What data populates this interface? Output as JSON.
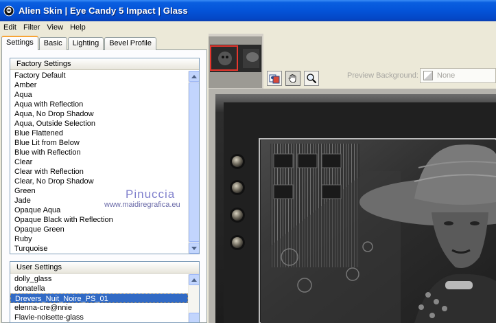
{
  "window": {
    "title": "Alien Skin | Eye Candy 5 Impact | Glass"
  },
  "menu": [
    "Edit",
    "Filter",
    "View",
    "Help"
  ],
  "tabs": [
    "Settings",
    "Basic",
    "Lighting",
    "Bevel Profile"
  ],
  "factory_settings": {
    "header": "Factory Settings",
    "items": [
      "Factory Default",
      "Amber",
      "Aqua",
      "Aqua with Reflection",
      "Aqua, No Drop Shadow",
      "Aqua, Outside Selection",
      "Blue Flattened",
      "Blue Lit from Below",
      "Blue with Reflection",
      "Clear",
      "Clear with Reflection",
      "Clear, No Drop Shadow",
      "Green",
      "Jade",
      "Opaque Aqua",
      "Opaque Black with Reflection",
      "Opaque Green",
      "Ruby",
      "Turquoise"
    ]
  },
  "user_settings": {
    "header": "User Settings",
    "items": [
      "dolly_glass",
      "donatella",
      "Drevers_Nuit_Noire_PS_01",
      "elenna-cre@nnie",
      "Flavie-noisette-glass"
    ],
    "selected": "Drevers_Nuit_Noire_PS_01"
  },
  "watermark": {
    "name": "Pinuccia",
    "url": "www.maidiregrafica.eu"
  },
  "preview_background": {
    "label": "Preview Background:",
    "value": "None"
  },
  "colors": {
    "titlebar": "#0453d8",
    "selection": "#316ac5",
    "tab_accent": "#f7a436",
    "thumb_frame": "#e8362d"
  },
  "icons": {
    "app": "alien-skin-icon",
    "compare": "compare-preview-icon",
    "hand": "hand-pan-icon",
    "zoom": "magnifier-zoom-icon"
  }
}
